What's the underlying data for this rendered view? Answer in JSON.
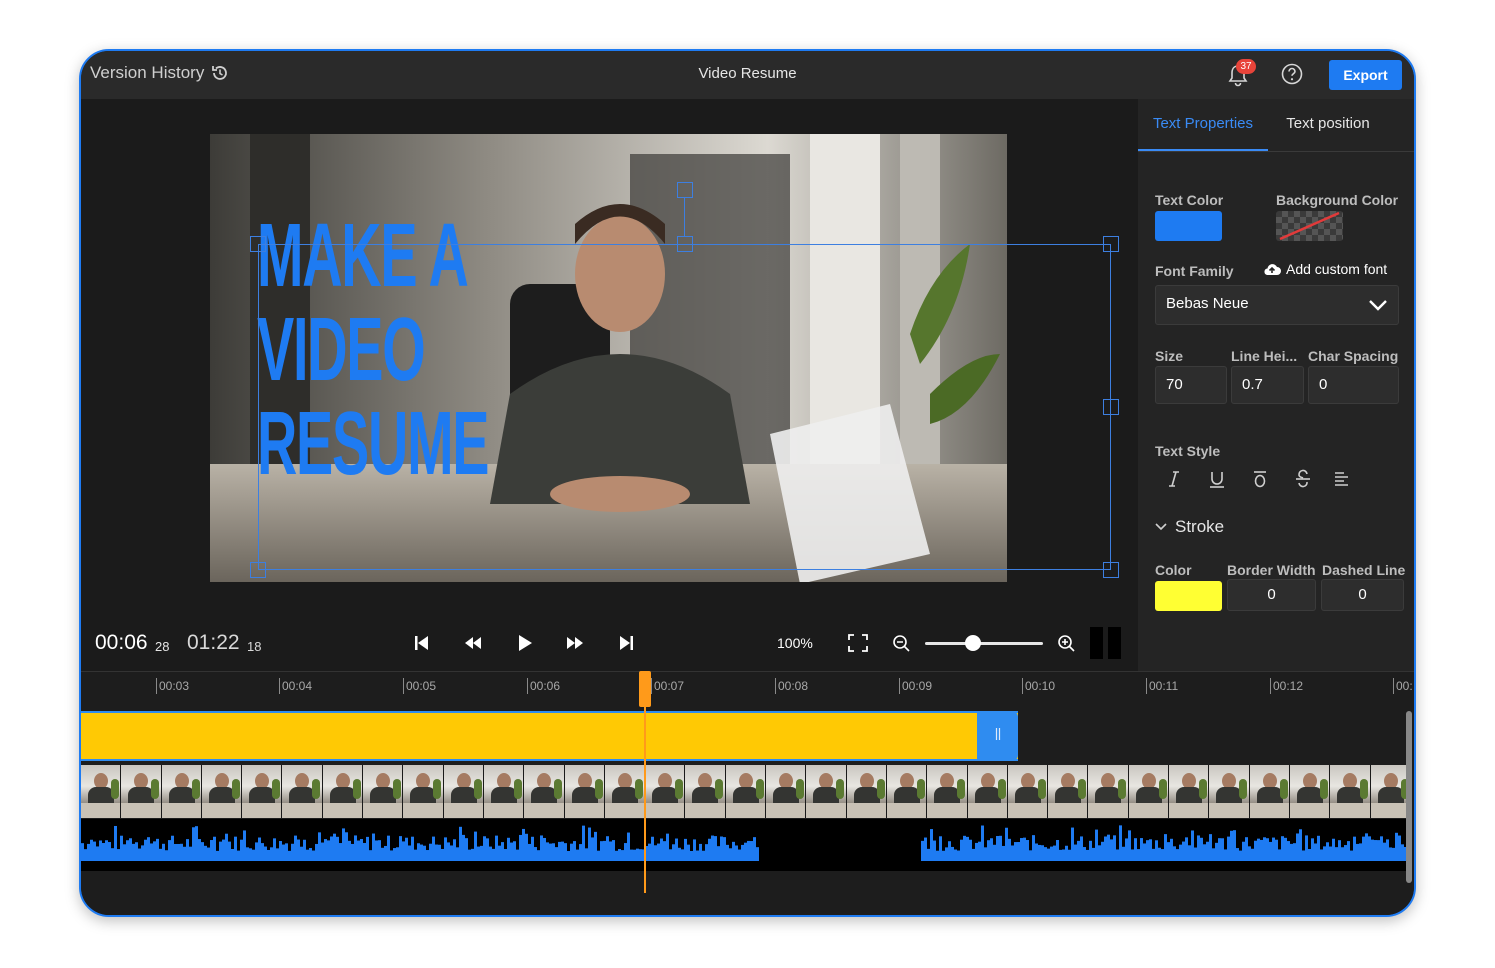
{
  "header": {
    "version_history_label": "Version History",
    "title": "Video Resume",
    "notification_count": "37",
    "export_label": "Export"
  },
  "preview": {
    "overlay_lines": [
      "MAKE A",
      "VIDEO",
      "RESUME"
    ],
    "overlay_color": "#1e7bf2"
  },
  "transport": {
    "current_time": "00:06",
    "current_frame": "28",
    "total_time": "01:22",
    "total_frame": "18",
    "zoom": "100%",
    "zoom_slider_level": 0.41
  },
  "panel": {
    "tabs": [
      {
        "label": "Text Properties",
        "active": true
      },
      {
        "label": "Text position",
        "active": false
      }
    ],
    "text_color_label": "Text Color",
    "text_color": "#1e7bf2",
    "background_color_label": "Background Color",
    "font_family_label": "Font Family",
    "add_custom_font_label": "Add custom font",
    "font_family_value": "Bebas Neue",
    "size_label": "Size",
    "size_value": "70",
    "line_height_label": "Line Hei...",
    "line_height_value": "0.7",
    "char_spacing_label": "Char Spacing",
    "char_spacing_value": "0",
    "text_style_label": "Text Style",
    "stroke_label": "Stroke",
    "stroke_color_label": "Color",
    "stroke_color": "#ffff33",
    "border_width_label": "Border Width",
    "border_width_value": "0",
    "dashed_line_label": "Dashed Line",
    "dashed_line_value": "0"
  },
  "timeline": {
    "ticks": [
      "00:03",
      "00:04",
      "00:05",
      "00:06",
      "00:07",
      "00:08",
      "00:09",
      "00:10",
      "00:11",
      "00:12",
      "00:"
    ],
    "text_clip_color": "#ffc904",
    "playhead_color": "#ff9a1a",
    "waveform_color": "#1e7bf2"
  }
}
